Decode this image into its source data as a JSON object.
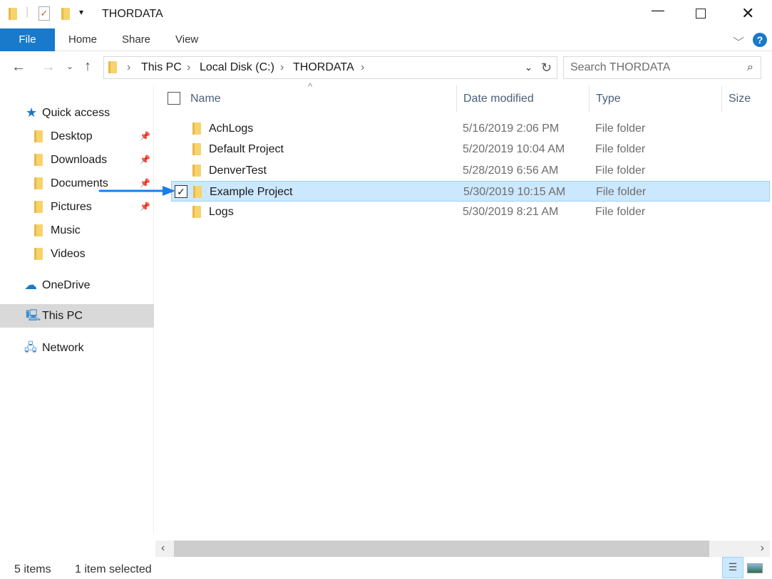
{
  "window": {
    "title": "THORDATA"
  },
  "ribbon": {
    "tabs": [
      "File",
      "Home",
      "Share",
      "View"
    ]
  },
  "address": {
    "crumbs": [
      "This PC",
      "Local Disk (C:)",
      "THORDATA"
    ],
    "search_placeholder": "Search THORDATA"
  },
  "sidebar": {
    "quick_access": "Quick access",
    "items": [
      {
        "label": "Desktop",
        "pinned": true
      },
      {
        "label": "Downloads",
        "pinned": true
      },
      {
        "label": "Documents",
        "pinned": true
      },
      {
        "label": "Pictures",
        "pinned": true
      },
      {
        "label": "Music"
      },
      {
        "label": "Videos"
      }
    ],
    "onedrive": "OneDrive",
    "this_pc": "This PC",
    "network": "Network"
  },
  "columns": {
    "name": "Name",
    "date": "Date modified",
    "type": "Type",
    "size": "Size"
  },
  "files": [
    {
      "name": "AchLogs",
      "date": "5/16/2019 2:06 PM",
      "type": "File folder"
    },
    {
      "name": "Default Project",
      "date": "5/20/2019 10:04 AM",
      "type": "File folder"
    },
    {
      "name": "DenverTest",
      "date": "5/28/2019 6:56 AM",
      "type": "File folder"
    },
    {
      "name": "Example Project",
      "date": "5/30/2019 10:15 AM",
      "type": "File folder",
      "selected": true
    },
    {
      "name": "Logs",
      "date": "5/30/2019 8:21 AM",
      "type": "File folder"
    }
  ],
  "status": {
    "count": "5 items",
    "selected": "1 item selected"
  },
  "colors": {
    "accent": "#1979ca",
    "selection": "#cce8ff",
    "arrow": "#1a7ee6"
  }
}
